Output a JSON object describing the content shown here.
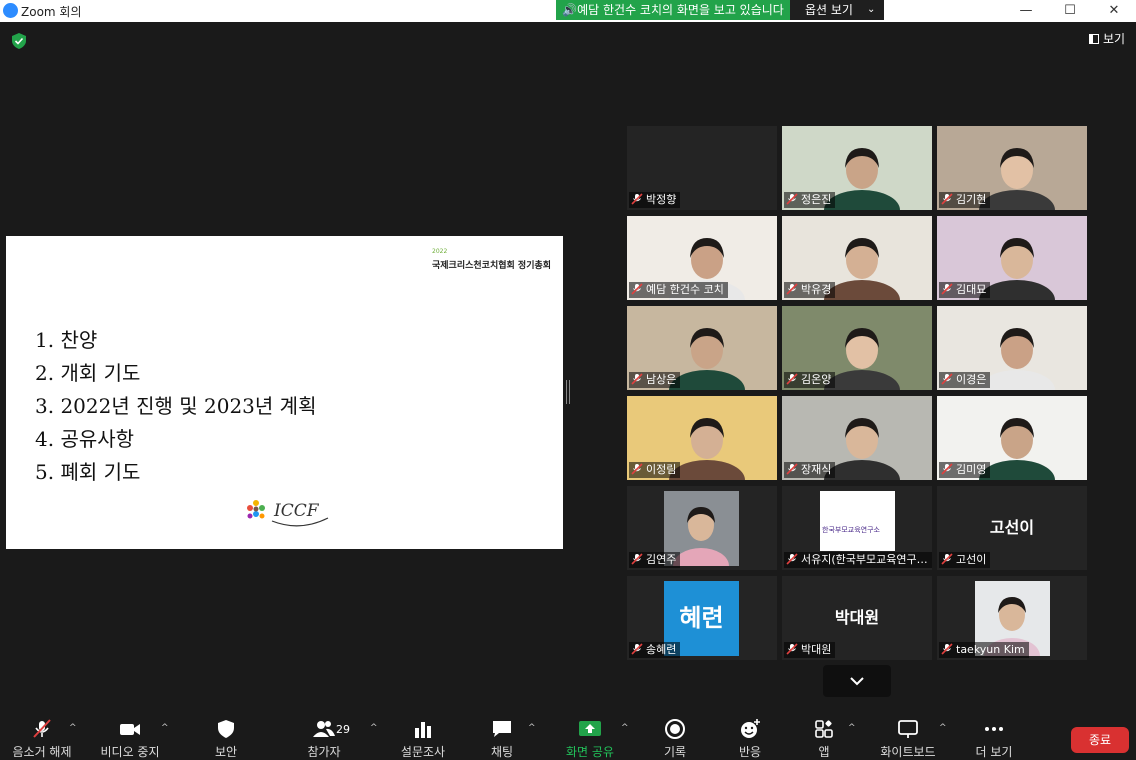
{
  "window": {
    "title": "Zoom 회의",
    "minimize": "—",
    "maximize": "☐",
    "close": "✕"
  },
  "share_banner": {
    "text": "예담 한건수 코치의 화면을 보고 있습니다",
    "options_label": "옵션 보기"
  },
  "view_label": "보기",
  "slide": {
    "year": "2022",
    "org_title": "국제크리스천코치협회 정기총회",
    "agenda": [
      "1. 찬양",
      "2. 개회 기도",
      "3. 2022년 진행 및 2023년 계획",
      "4. 공유사항",
      "5. 폐회 기도"
    ],
    "brand": "ICCF"
  },
  "participants": [
    {
      "name": "박정향",
      "display": "",
      "video": "dark"
    },
    {
      "name": "정은진",
      "display": "",
      "video": "person"
    },
    {
      "name": "김기현",
      "display": "",
      "video": "person"
    },
    {
      "name": "예담 한건수 코치",
      "display": "",
      "video": "person",
      "active": true
    },
    {
      "name": "박유경",
      "display": "",
      "video": "person"
    },
    {
      "name": "김대묘",
      "display": "",
      "video": "person"
    },
    {
      "name": "남상은",
      "display": "",
      "video": "person"
    },
    {
      "name": "김온양",
      "display": "",
      "video": "person"
    },
    {
      "name": "이경은",
      "display": "",
      "video": "person"
    },
    {
      "name": "이정림",
      "display": "",
      "video": "person"
    },
    {
      "name": "장재식",
      "display": "",
      "video": "person"
    },
    {
      "name": "김미영",
      "display": "",
      "video": "person"
    },
    {
      "name": "김연주",
      "display": "",
      "video": "photo"
    },
    {
      "name": "서유지(한국부모교육연구소)",
      "display": "",
      "video": "logo",
      "logo_text": "한국부모교육연구소"
    },
    {
      "name": "고선이",
      "display": "고선이",
      "video": "none"
    },
    {
      "name": "송혜련",
      "display": "",
      "video": "avatar",
      "avatar_text": "혜련"
    },
    {
      "name": "박대원",
      "display": "박대원",
      "video": "none"
    },
    {
      "name": "taekyun Kim",
      "display": "",
      "video": "photo"
    }
  ],
  "toolbar": {
    "mute": "음소거 해제",
    "video": "비디오 중지",
    "security": "보안",
    "participants": "참가자",
    "participants_count": "29",
    "polls": "설문조사",
    "chat": "채팅",
    "share": "화면 공유",
    "record": "기록",
    "reactions": "반응",
    "apps": "앱",
    "whiteboard": "화이트보드",
    "more": "더 보기",
    "end": "종료"
  },
  "colors": {
    "banner": "#22a34a",
    "end": "#d93131",
    "active_outline": "#c8e05a",
    "mic_muted": "#e0403f"
  }
}
